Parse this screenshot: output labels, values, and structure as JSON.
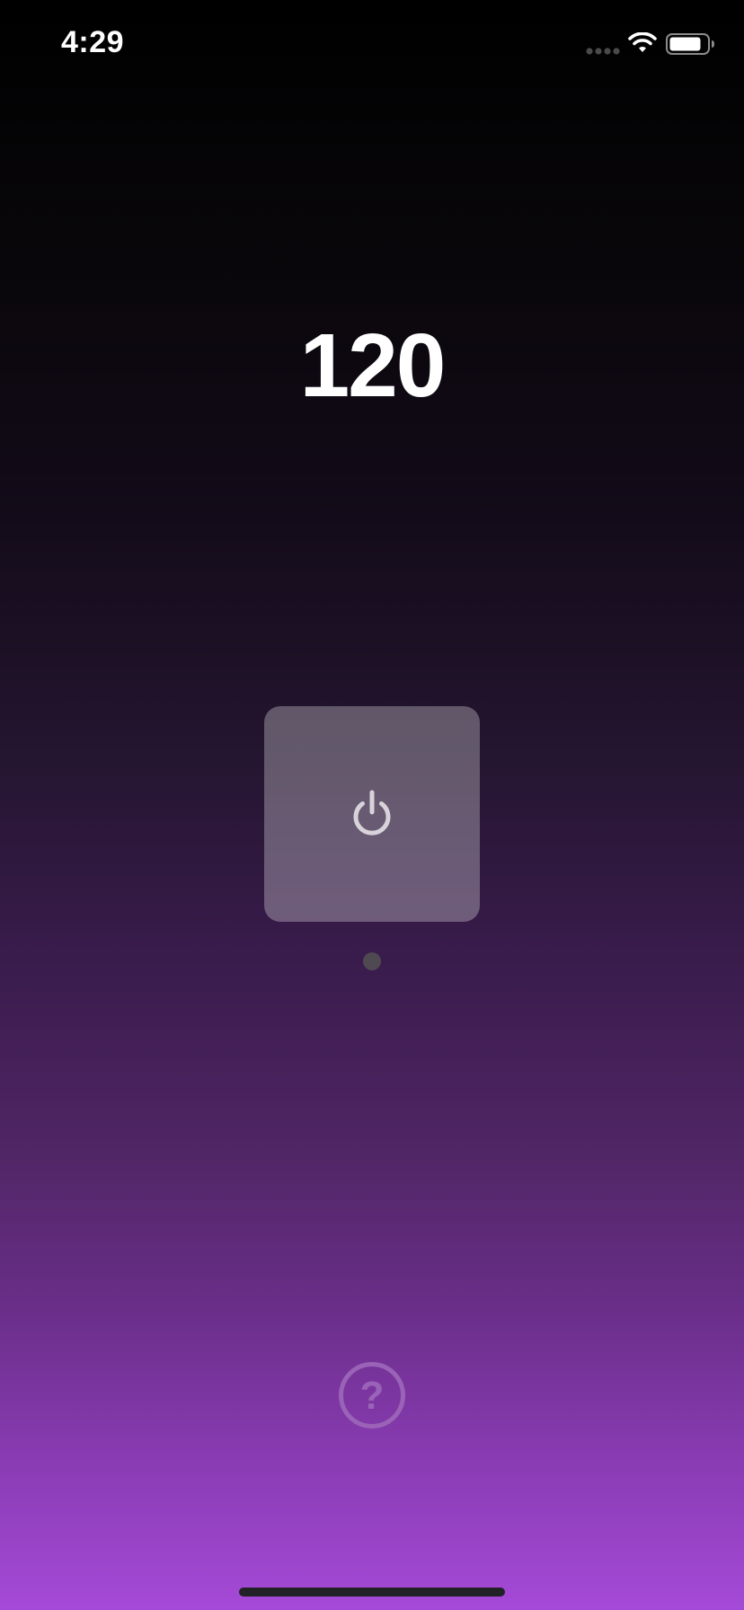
{
  "status_bar": {
    "time": "4:29",
    "signal_icon": "cellular-signal-icon",
    "wifi_icon": "wifi-icon",
    "battery_icon": "battery-icon",
    "battery_level": 0.85
  },
  "counter": {
    "value": "120"
  },
  "power_button": {
    "icon": "power-icon"
  },
  "page_indicator": {
    "count": 1,
    "active_index": 0
  },
  "help_button": {
    "icon": "question-mark-icon",
    "glyph": "?"
  },
  "colors": {
    "background_top": "#000000",
    "background_bottom": "#a54ad8",
    "power_button_bg": "rgba(255,255,255,0.29)",
    "power_icon": "#d8d3da",
    "dot": "#4f4a52",
    "help_icon": "#9a63b7"
  }
}
